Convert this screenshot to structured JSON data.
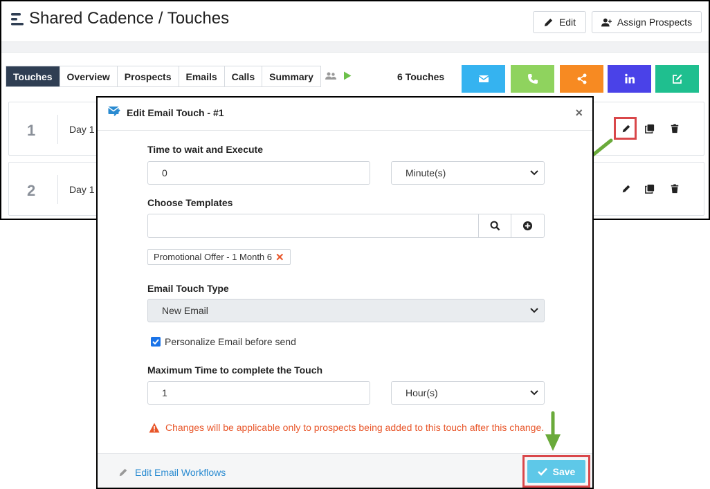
{
  "header": {
    "title": "Shared Cadence / Touches",
    "edit_label": "Edit",
    "assign_label": "Assign Prospects"
  },
  "tabs": [
    {
      "label": "Touches",
      "active": true
    },
    {
      "label": "Overview",
      "active": false
    },
    {
      "label": "Prospects",
      "active": false
    },
    {
      "label": "Emails",
      "active": false
    },
    {
      "label": "Calls",
      "active": false
    },
    {
      "label": "Summary",
      "active": false
    }
  ],
  "touch_count": "6 Touches",
  "channel_buttons": [
    {
      "name": "email",
      "icon": "envelope-icon",
      "color": "#35b3f0"
    },
    {
      "name": "call",
      "icon": "phone-icon",
      "color": "#8fd35e"
    },
    {
      "name": "share",
      "icon": "share-icon",
      "color": "#f78a22"
    },
    {
      "name": "linkedin",
      "icon": "linkedin-icon",
      "color": "#4a42e8"
    },
    {
      "name": "task",
      "icon": "edit-square-icon",
      "color": "#1fbf8f"
    }
  ],
  "touch_rows": [
    {
      "number": "1",
      "day": "Day 1"
    },
    {
      "number": "2",
      "day": "Day 1"
    }
  ],
  "modal": {
    "title": "Edit Email Touch - #1",
    "close_glyph": "×",
    "wait_label": "Time to wait and Execute",
    "wait_value": "0",
    "wait_unit": "Minute(s)",
    "templates_label": "Choose Templates",
    "templates_value": "",
    "selected_template": "Promotional Offer - 1 Month 6",
    "chip_remove": "✕",
    "touch_type_label": "Email Touch Type",
    "touch_type_value": "New Email",
    "personalize_label": "Personalize Email before send",
    "personalize_checked": true,
    "max_time_label": "Maximum Time to complete the Touch",
    "max_time_value": "1",
    "max_time_unit": "Hour(s)",
    "warning": "Changes will be applicable only to prospects being added to this touch after this change.",
    "workflows_link": "Edit Email Workflows",
    "save_label": "Save"
  },
  "colors": {
    "active_tab": "#2f3e53",
    "highlight": "#d9474a",
    "annotation_arrow": "#6aaa3a",
    "warning": "#e8562a",
    "link": "#2a8bd1",
    "save": "#5ec8e8"
  }
}
